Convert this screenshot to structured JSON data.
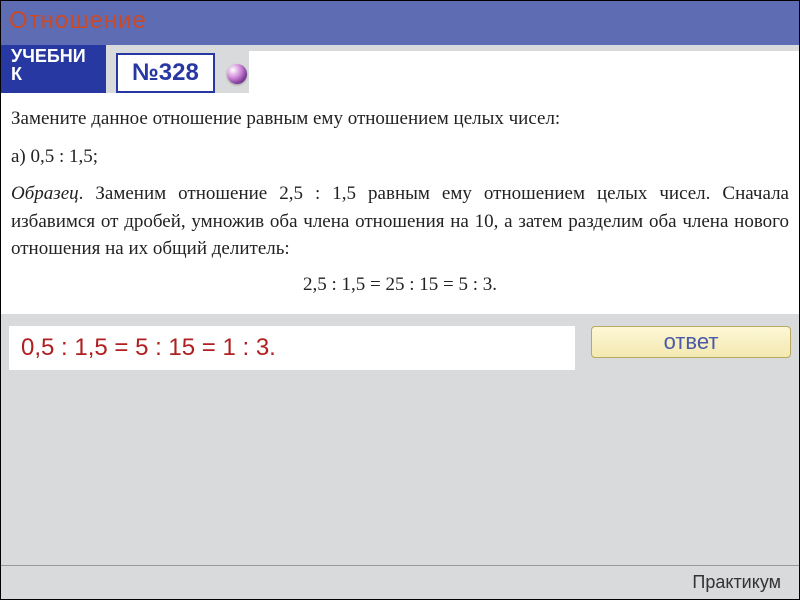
{
  "header": {
    "title": "Отношение"
  },
  "toolbar": {
    "textbook_label": "УЧЕБНИК",
    "number_label": "№328"
  },
  "problem": {
    "intro": "Замените данное отношение равным ему отношением целых чисел:",
    "item_a": "а) 0,5 : 1,5;",
    "example_label": "Образец",
    "example_body": ". Заменим отношение 2,5 : 1,5 равным ему отношением целых чисел. Сначала избавимся от дробей, умножив оба члена отношения на 10, а затем разделим оба члена нового отношения на их общий делитель:",
    "example_formula": "2,5 : 1,5 = 25 : 15 = 5 : 3."
  },
  "answer": {
    "text": "0,5 : 1,5 = 5 : 15 = 1 : 3.",
    "button_label": "ответ"
  },
  "footer": {
    "label": "Практикум"
  }
}
